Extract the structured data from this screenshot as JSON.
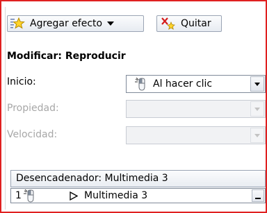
{
  "toolbar": {
    "add_effect_label": "Agregar efecto",
    "remove_label": "Quitar"
  },
  "section": {
    "title": "Modificar: Reproducir"
  },
  "fields": {
    "start_label": "Inicio:",
    "start_value": "Al hacer clic",
    "property_label": "Propiedad:",
    "property_value": "",
    "speed_label": "Velocidad:",
    "speed_value": ""
  },
  "trigger": {
    "label": "Desencadenador: Multimedia 3"
  },
  "effects": [
    {
      "index": "1",
      "name": "Multimedia 3"
    }
  ],
  "icons": {
    "add_effect": "star-sparkle-icon",
    "remove": "remove-x-icon",
    "start_trigger": "mouse-click-icon",
    "effect_type": "play-icon"
  },
  "colors": {
    "frame_border": "#e02020",
    "disabled_text": "#a7a7a7",
    "button_border": "#9aa4b4"
  }
}
